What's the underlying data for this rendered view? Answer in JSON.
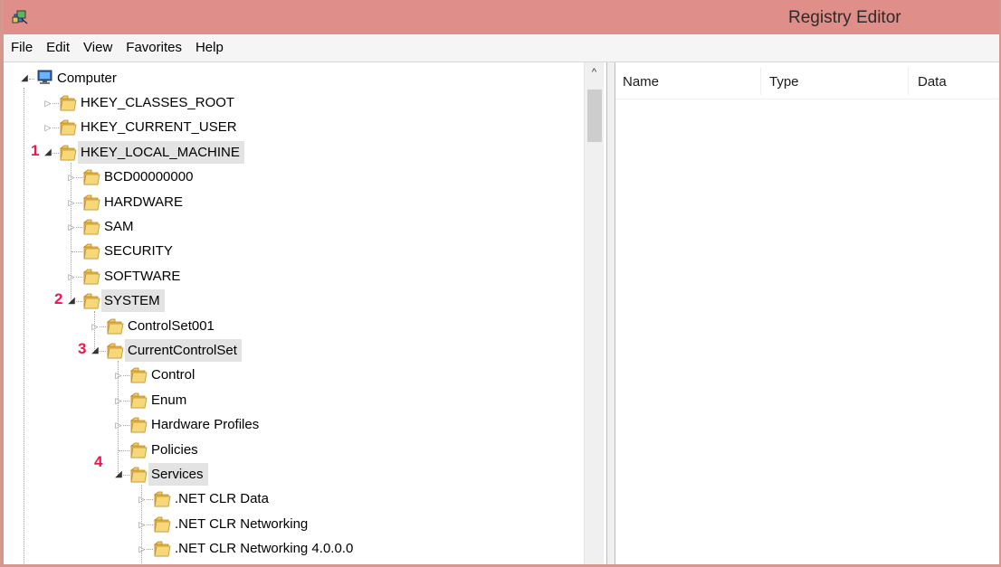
{
  "window": {
    "title": "Registry Editor",
    "accent_color": "#e08e89",
    "icon": "registry-editor-icon"
  },
  "menu": [
    "File",
    "Edit",
    "View",
    "Favorites",
    "Help"
  ],
  "list": {
    "columns": [
      "Name",
      "Type",
      "Data"
    ]
  },
  "tree": {
    "root": "Computer",
    "items": [
      {
        "label": "HKEY_CLASSES_ROOT",
        "depth": 1,
        "state": "collapsed"
      },
      {
        "label": "HKEY_CURRENT_USER",
        "depth": 1,
        "state": "collapsed"
      },
      {
        "label": "HKEY_LOCAL_MACHINE",
        "depth": 1,
        "state": "expanded",
        "selected": true,
        "step": "1"
      },
      {
        "label": "BCD00000000",
        "depth": 2,
        "state": "collapsed"
      },
      {
        "label": "HARDWARE",
        "depth": 2,
        "state": "collapsed"
      },
      {
        "label": "SAM",
        "depth": 2,
        "state": "collapsed"
      },
      {
        "label": "SECURITY",
        "depth": 2,
        "state": "leaf"
      },
      {
        "label": "SOFTWARE",
        "depth": 2,
        "state": "collapsed"
      },
      {
        "label": "SYSTEM",
        "depth": 2,
        "state": "expanded",
        "selected": true,
        "step": "2"
      },
      {
        "label": "ControlSet001",
        "depth": 3,
        "state": "collapsed"
      },
      {
        "label": "CurrentControlSet",
        "depth": 3,
        "state": "expanded",
        "selected": true,
        "step": "3"
      },
      {
        "label": "Control",
        "depth": 4,
        "state": "collapsed"
      },
      {
        "label": "Enum",
        "depth": 4,
        "state": "collapsed"
      },
      {
        "label": "Hardware Profiles",
        "depth": 4,
        "state": "collapsed"
      },
      {
        "label": "Policies",
        "depth": 4,
        "state": "leaf"
      },
      {
        "label": "Services",
        "depth": 4,
        "state": "expanded",
        "selected": true,
        "step": "4"
      },
      {
        "label": ".NET CLR Data",
        "depth": 5,
        "state": "collapsed"
      },
      {
        "label": ".NET CLR Networking",
        "depth": 5,
        "state": "collapsed"
      },
      {
        "label": ".NET CLR Networking 4.0.0.0",
        "depth": 5,
        "state": "collapsed"
      }
    ]
  }
}
